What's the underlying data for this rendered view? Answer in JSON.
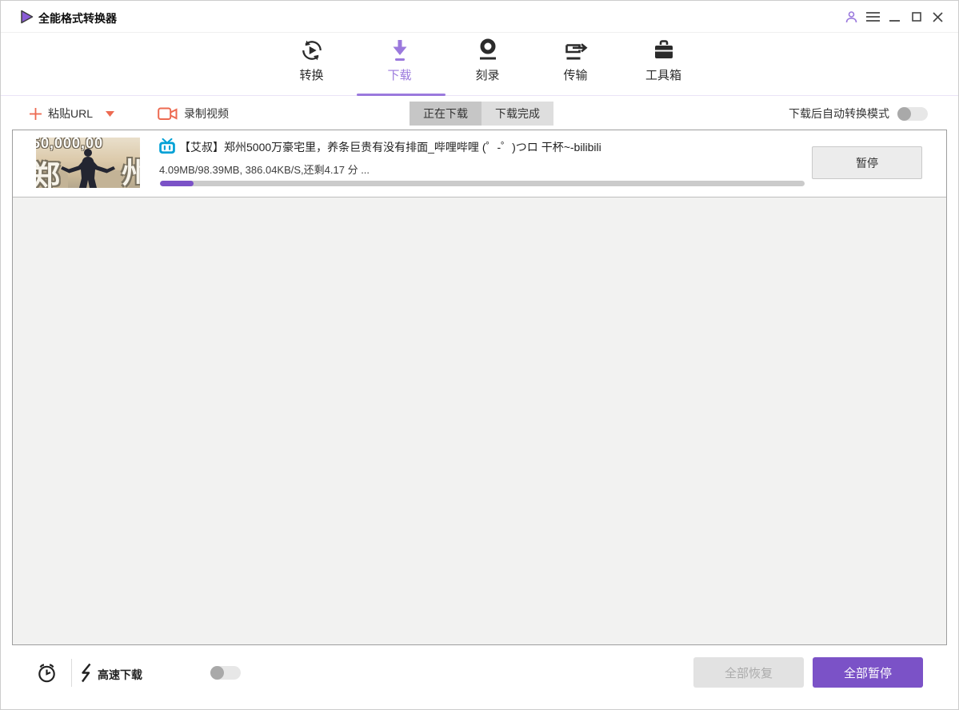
{
  "titlebar": {
    "app_title": "全能格式转换器"
  },
  "nav": {
    "active_tab": "下载",
    "tabs": [
      {
        "label": "转换",
        "icon": "convert-icon"
      },
      {
        "label": "下载",
        "icon": "download-icon"
      },
      {
        "label": "刻录",
        "icon": "burn-icon"
      },
      {
        "label": "传输",
        "icon": "transfer-icon"
      },
      {
        "label": "工具箱",
        "icon": "toolbox-icon"
      }
    ]
  },
  "toolbar": {
    "paste_url": "粘贴URL",
    "record_video": "录制视频",
    "filter_tabs": [
      {
        "label": "正在下载",
        "active": true
      },
      {
        "label": "下载完成",
        "active": false
      }
    ],
    "auto_convert_label": "下载后自动转换模式",
    "auto_convert_enabled": false
  },
  "downloads": [
    {
      "source": "bilibili",
      "title": "【艾叔】郑州5000万豪宅里，养条巨贵有没有排面_哔哩哔哩 (゜-゜)つロ 干杯~-bilibili",
      "status_text": "4.09MB/98.39MB, 386.04KB/S,还剩4.17 分 ...",
      "progress_percent": 5.2,
      "action_label": "暂停",
      "thumbnail": {
        "caption_top": "50,000,00",
        "char_left": "郑",
        "char_right": "州"
      }
    }
  ],
  "footer": {
    "high_speed_label": "高速下载",
    "high_speed_enabled": false,
    "resume_all": "全部恢复",
    "pause_all": "全部暂停"
  },
  "colors": {
    "accent_purple": "#7b52c7",
    "accent_purple_light": "#9b79dd",
    "coral": "#ed6a51",
    "bilibili_blue": "#00a1d6",
    "icon_dark": "#2b2b2b"
  }
}
